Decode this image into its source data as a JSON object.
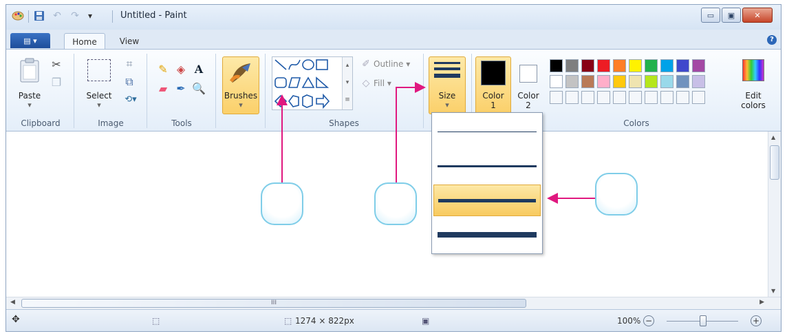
{
  "window": {
    "title": "Untitled - Paint",
    "controls": {
      "minimize": "▭",
      "maximize": "▣",
      "close": "✕"
    }
  },
  "quick_access": {
    "undo_icon": "↶",
    "redo_icon": "↷",
    "customize_icon": "▾"
  },
  "tabs": [
    {
      "label": "Home",
      "active": true
    },
    {
      "label": "View",
      "active": false
    }
  ],
  "help_icon": "?",
  "ribbon": {
    "clipboard": {
      "group_label": "Clipboard",
      "paste_label": "Paste"
    },
    "image": {
      "group_label": "Image",
      "select_label": "Select"
    },
    "tools": {
      "group_label": "Tools"
    },
    "brushes": {
      "label": "Brushes"
    },
    "shapes": {
      "group_label": "Shapes",
      "outline_label": "Outline",
      "fill_label": "Fill"
    },
    "size": {
      "label": "Size"
    },
    "color1": {
      "label_top": "Color",
      "label_bottom": "1",
      "value": "#000000"
    },
    "color2": {
      "label_top": "Color",
      "label_bottom": "2",
      "value": "#ffffff"
    },
    "colors": {
      "group_label": "Colors",
      "edit_label_top": "Edit",
      "edit_label_bottom": "colors"
    }
  },
  "palette_row1": [
    "#000000",
    "#7f7f7f",
    "#880015",
    "#ed1c24",
    "#ff7f27",
    "#fff200",
    "#22b14c",
    "#00a2e8",
    "#3f48cc",
    "#a349a4"
  ],
  "palette_row2": [
    "#ffffff",
    "#c3c3c3",
    "#b97a57",
    "#ffaec9",
    "#ffc90e",
    "#efe4b0",
    "#b5e61d",
    "#99d9ea",
    "#7092be",
    "#c8bfe7"
  ],
  "size_options": [
    {
      "thickness": 1,
      "selected": false
    },
    {
      "thickness": 3,
      "selected": false
    },
    {
      "thickness": 5,
      "selected": true
    },
    {
      "thickness": 8,
      "selected": false
    }
  ],
  "status": {
    "canvas_size": "1274 × 822px",
    "zoom": "100%",
    "zoom_out": "−",
    "zoom_in": "+"
  },
  "scroll": {
    "h_grip": "III"
  },
  "accent_color": "#e0187f"
}
